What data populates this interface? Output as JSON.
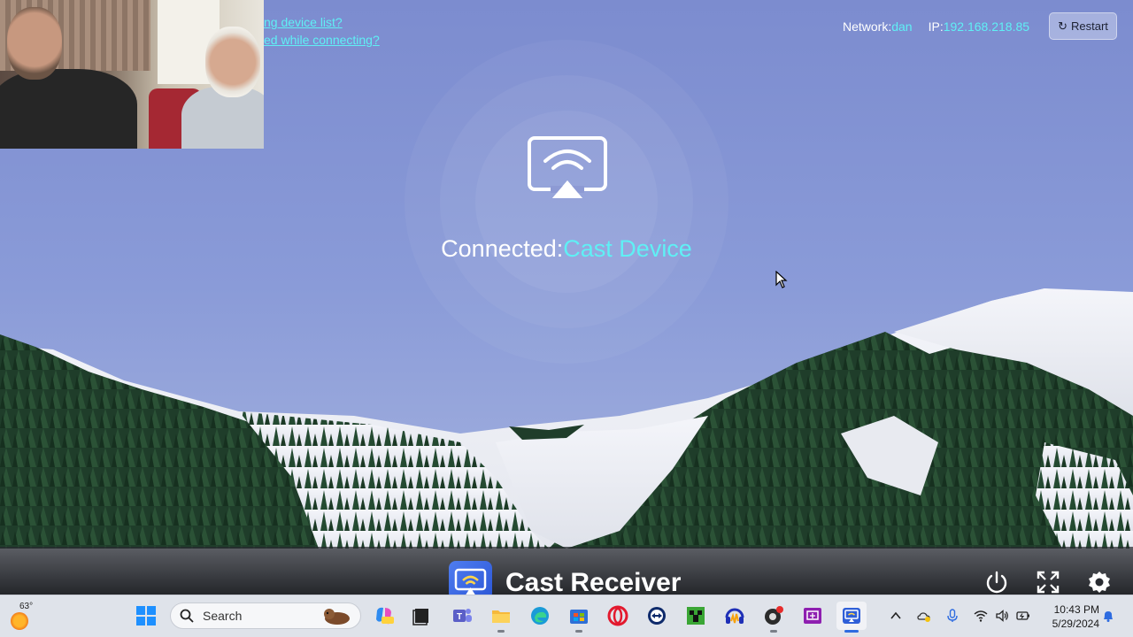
{
  "webcam": {
    "description": ""
  },
  "help": {
    "link1": "ng device list?",
    "link2": "ed while connecting?"
  },
  "network": {
    "network_label": "Network:",
    "network_value": "dan",
    "ip_label": "IP:",
    "ip_value": "192.168.218.85",
    "restart_label": "Restart"
  },
  "cast": {
    "connected_label": "Connected:",
    "device_name": "Cast Device"
  },
  "app": {
    "title": "Cast Receiver",
    "controls": [
      "power-icon",
      "fullscreen-icon",
      "settings-icon"
    ]
  },
  "taskbar": {
    "weather_temp": "63°",
    "search_placeholder": "Search",
    "apps": [
      "windows-start-icon",
      "copilot-icon",
      "task-view-icon",
      "teams-icon",
      "file-explorer-icon",
      "edge-icon",
      "store-icon",
      "opera-icon",
      "teamviewer-icon",
      "minecraft-icon",
      "audio-app-icon",
      "obs-icon",
      "screen-app-icon",
      "cast-receiver-icon"
    ],
    "tray": [
      "chevron-up-icon",
      "onedrive-icon",
      "microphone-icon",
      "wifi-icon",
      "volume-icon",
      "battery-icon"
    ],
    "time": "10:43 PM",
    "date": "5/29/2024"
  },
  "colors": {
    "accent_cyan": "#5ff0f5",
    "sky": "#7e8fd0"
  }
}
